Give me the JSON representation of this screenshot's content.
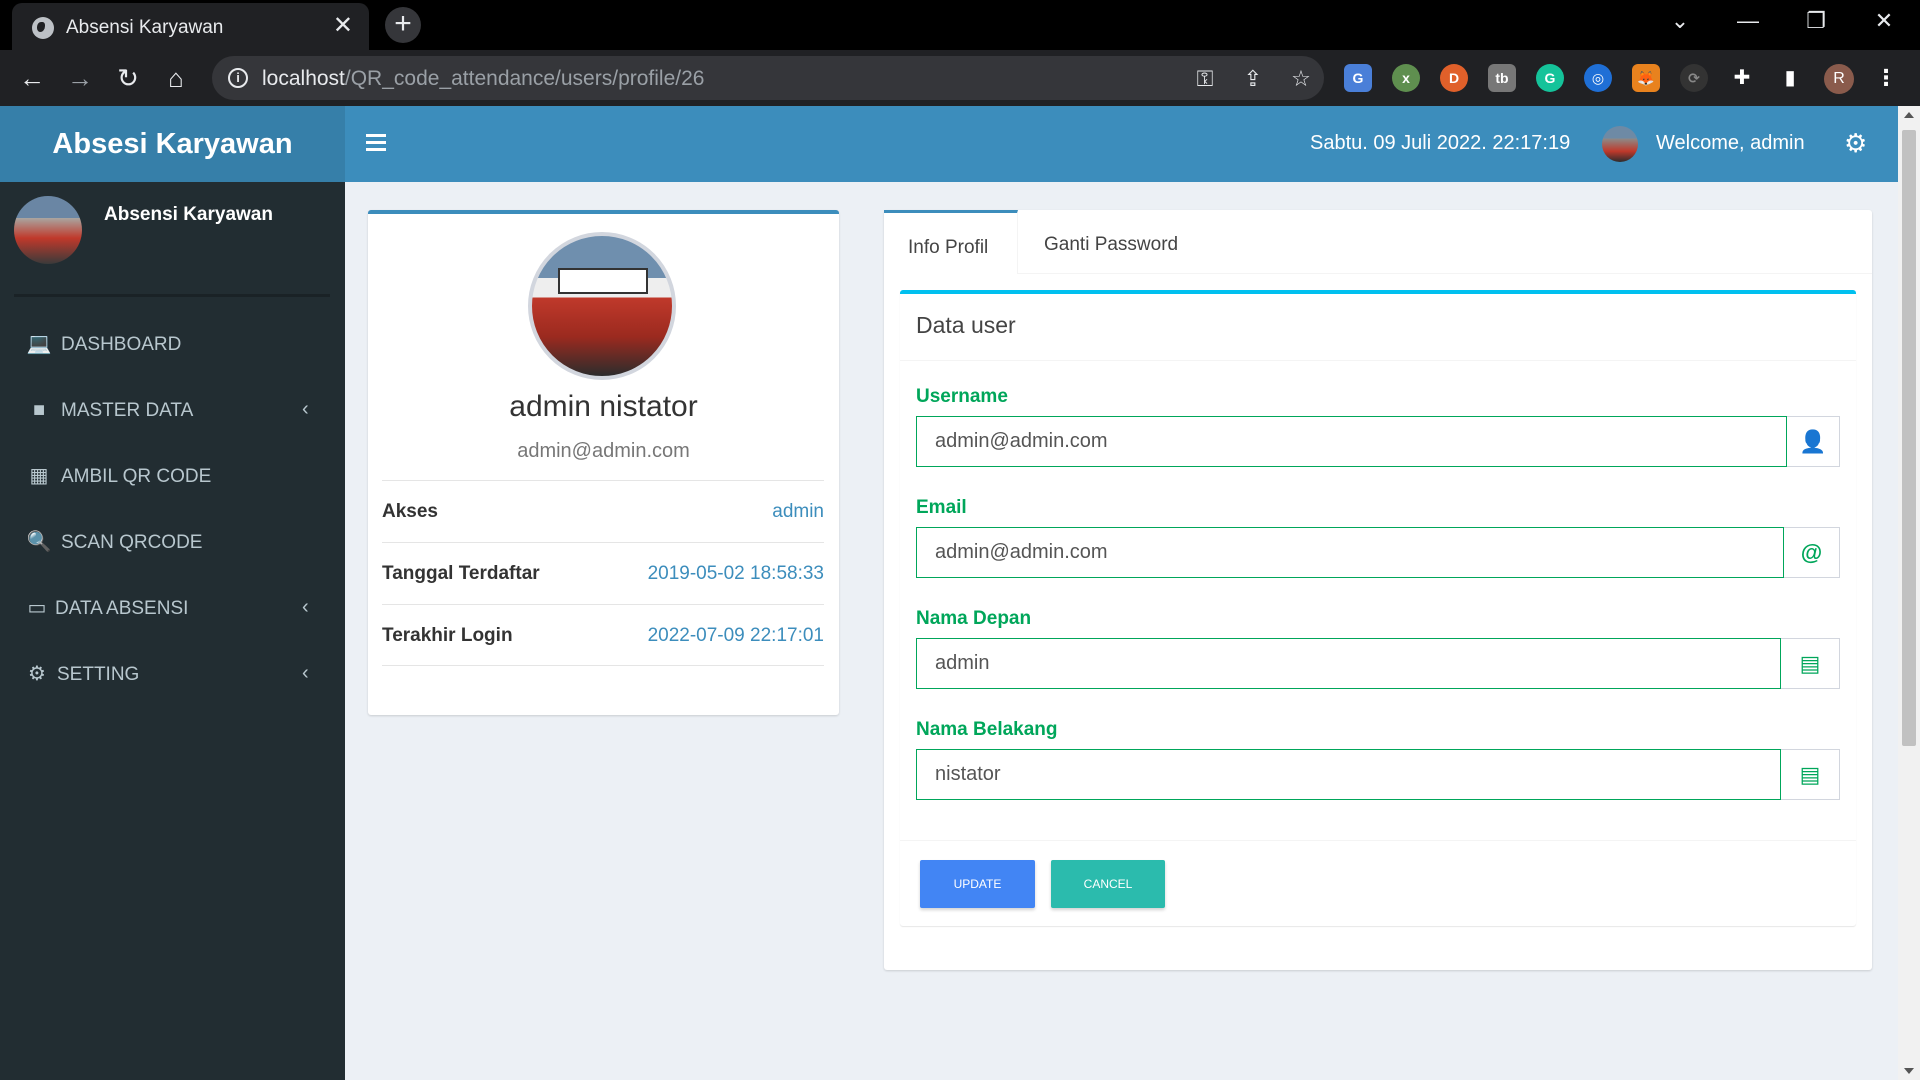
{
  "browser": {
    "tab_title": "Absensi Karyawan",
    "url_host": "localhost",
    "url_path": "/QR_code_attendance/users/profile/26",
    "profile_initial": "R"
  },
  "app": {
    "brand": "Absesi Karyawan",
    "datetime": "Sabtu. 09 Juli 2022. 22:17:19",
    "welcome": "Welcome, admin",
    "colors": {
      "header": "#3c8dbc",
      "sidebar": "#222d32",
      "success": "#00a65a",
      "update": "#4285f4",
      "cancel": "#2bbbad"
    }
  },
  "sidebar": {
    "user_name": "Absensi Karyawan",
    "items": [
      {
        "label": "DASHBOARD",
        "icon": "laptop-icon"
      },
      {
        "label": "MASTER DATA",
        "icon": "folder-icon"
      },
      {
        "label": "AMBIL QR CODE",
        "icon": "qrcode-icon"
      },
      {
        "label": "SCAN QRCODE",
        "icon": "search-plus-icon"
      },
      {
        "label": "DATA ABSENSI",
        "icon": "folder-open-icon"
      },
      {
        "label": "SETTING",
        "icon": "cogs-icon"
      }
    ]
  },
  "profile": {
    "name": "admin nistator",
    "email": "admin@admin.com",
    "rows": [
      {
        "key": "Akses",
        "value": "admin"
      },
      {
        "key": "Tanggal Terdaftar",
        "value": "2019-05-02 18:58:33"
      },
      {
        "key": "Terakhir Login",
        "value": "2022-07-09 22:17:01"
      }
    ]
  },
  "tabs": {
    "items": [
      "Info Profil",
      "Ganti Password"
    ]
  },
  "form": {
    "title": "Data user",
    "fields": [
      {
        "label": "Username",
        "value": "admin@admin.com",
        "icon": "user-icon"
      },
      {
        "label": "Email",
        "value": "admin@admin.com",
        "icon": "at-icon"
      },
      {
        "label": "Nama Depan",
        "value": "admin",
        "icon": "id-card-icon"
      },
      {
        "label": "Nama Belakang",
        "value": "nistator",
        "icon": "id-card-icon"
      }
    ],
    "update_label": "UPDATE",
    "cancel_label": "CANCEL"
  }
}
